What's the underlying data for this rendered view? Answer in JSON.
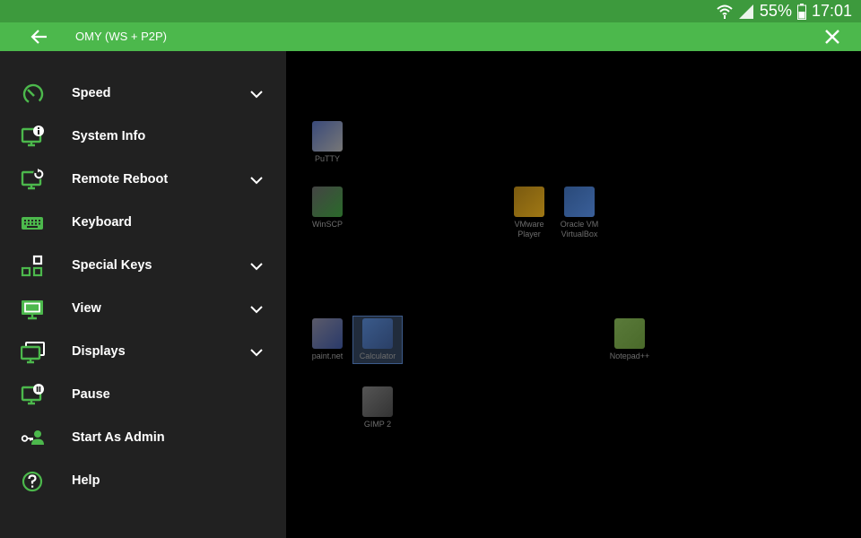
{
  "status_bar": {
    "battery": "55%",
    "time": "17:01"
  },
  "app_bar": {
    "title": "OMY (WS + P2P)"
  },
  "colors": {
    "accent": "#4cb84c",
    "status": "#3d9a3d",
    "drawer_bg": "#212121"
  },
  "menu": {
    "items": [
      {
        "label": "Speed",
        "icon": "speedometer-icon",
        "expandable": true
      },
      {
        "label": "System Info",
        "icon": "monitor-info-icon",
        "expandable": false
      },
      {
        "label": "Remote Reboot",
        "icon": "monitor-reboot-icon",
        "expandable": true
      },
      {
        "label": "Keyboard",
        "icon": "keyboard-icon",
        "expandable": false
      },
      {
        "label": "Special Keys",
        "icon": "special-keys-icon",
        "expandable": true
      },
      {
        "label": "View",
        "icon": "monitor-view-icon",
        "expandable": true
      },
      {
        "label": "Displays",
        "icon": "displays-icon",
        "expandable": true
      },
      {
        "label": "Pause",
        "icon": "monitor-pause-icon",
        "expandable": false
      },
      {
        "label": "Start As Admin",
        "icon": "admin-key-icon",
        "expandable": false
      },
      {
        "label": "Help",
        "icon": "help-icon",
        "expandable": false
      }
    ]
  },
  "desktop": {
    "icons": [
      {
        "label": "PuTTY"
      },
      {
        "label": "WinSCP"
      },
      {
        "label": "VMware Player"
      },
      {
        "label": "Oracle VM VirtualBox"
      },
      {
        "label": "paint.net"
      },
      {
        "label": "Calculator"
      },
      {
        "label": "Notepad++"
      },
      {
        "label": "GIMP 2"
      }
    ]
  }
}
